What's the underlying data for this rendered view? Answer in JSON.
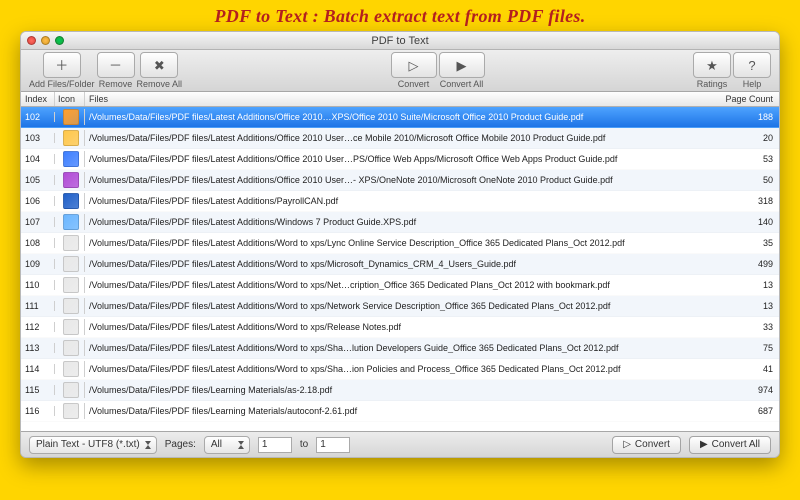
{
  "headline": "PDF to Text : Batch extract text from PDF files.",
  "window": {
    "title": "PDF to Text"
  },
  "toolbar": {
    "add": "Add Files/Folder",
    "remove": "Remove",
    "removeAll": "Remove All",
    "convert": "Convert",
    "convertAll": "Convert All",
    "ratings": "Ratings",
    "help": "Help"
  },
  "columns": {
    "index": "Index",
    "icon": "Icon",
    "files": "Files",
    "pages": "Page Count"
  },
  "footer": {
    "format": "Plain Text - UTF8 (*.txt)",
    "pagesLabel": "Pages:",
    "pagesMode": "All",
    "pageFrom": "1",
    "toLabel": "to",
    "pageTo": "1",
    "convert": "Convert",
    "convertAll": "Convert All"
  },
  "rows": [
    {
      "index": "102",
      "color": "#ff9f2e",
      "path": "/Volumes/Data/Files/PDF files/Latest Additions/Office 2010…XPS/Office 2010 Suite/Microsoft Office 2010 Product Guide.pdf",
      "pages": "188",
      "selected": true
    },
    {
      "index": "103",
      "color": "#ffc74a",
      "path": "/Volumes/Data/Files/PDF files/Latest Additions/Office 2010 User…ce Mobile 2010/Microsoft Office Mobile 2010 Product Guide.pdf",
      "pages": "20"
    },
    {
      "index": "104",
      "color": "#3e7fff",
      "path": "/Volumes/Data/Files/PDF files/Latest Additions/Office 2010 User…PS/Office Web Apps/Microsoft Office Web Apps Product Guide.pdf",
      "pages": "53"
    },
    {
      "index": "105",
      "color": "#b14bd6",
      "path": "/Volumes/Data/Files/PDF files/Latest Additions/Office 2010 User…- XPS/OneNote 2010/Microsoft OneNote 2010 Product Guide.pdf",
      "pages": "50"
    },
    {
      "index": "106",
      "color": "#2060c9",
      "path": "/Volumes/Data/Files/PDF files/Latest Additions/PayrollCAN.pdf",
      "pages": "318"
    },
    {
      "index": "107",
      "color": "#6bb6ff",
      "path": "/Volumes/Data/Files/PDF files/Latest Additions/Windows 7 Product Guide.XPS.pdf",
      "pages": "140"
    },
    {
      "index": "108",
      "color": "#e8e8e8",
      "path": "/Volumes/Data/Files/PDF files/Latest Additions/Word to xps/Lync Online Service Description_Office 365 Dedicated Plans_Oct 2012.pdf",
      "pages": "35"
    },
    {
      "index": "109",
      "color": "#e8e8e8",
      "path": "/Volumes/Data/Files/PDF files/Latest Additions/Word to xps/Microsoft_Dynamics_CRM_4_Users_Guide.pdf",
      "pages": "499"
    },
    {
      "index": "110",
      "color": "#e8e8e8",
      "path": "/Volumes/Data/Files/PDF files/Latest Additions/Word to xps/Net…cription_Office 365 Dedicated Plans_Oct 2012 with bookmark.pdf",
      "pages": "13"
    },
    {
      "index": "111",
      "color": "#e8e8e8",
      "path": "/Volumes/Data/Files/PDF files/Latest Additions/Word to xps/Network Service Description_Office 365 Dedicated Plans_Oct 2012.pdf",
      "pages": "13"
    },
    {
      "index": "112",
      "color": "#e8e8e8",
      "path": "/Volumes/Data/Files/PDF files/Latest Additions/Word to xps/Release Notes.pdf",
      "pages": "33"
    },
    {
      "index": "113",
      "color": "#e8e8e8",
      "path": "/Volumes/Data/Files/PDF files/Latest Additions/Word to xps/Sha…lution Developers Guide_Office 365 Dedicated Plans_Oct 2012.pdf",
      "pages": "75"
    },
    {
      "index": "114",
      "color": "#e8e8e8",
      "path": "/Volumes/Data/Files/PDF files/Latest Additions/Word to xps/Sha…ion Policies and Process_Office 365 Dedicated Plans_Oct 2012.pdf",
      "pages": "41"
    },
    {
      "index": "115",
      "color": "#e8e8e8",
      "path": "/Volumes/Data/Files/PDF files/Learning Materials/as-2.18.pdf",
      "pages": "974"
    },
    {
      "index": "116",
      "color": "#e8e8e8",
      "path": "/Volumes/Data/Files/PDF files/Learning Materials/autoconf-2.61.pdf",
      "pages": "687"
    }
  ]
}
